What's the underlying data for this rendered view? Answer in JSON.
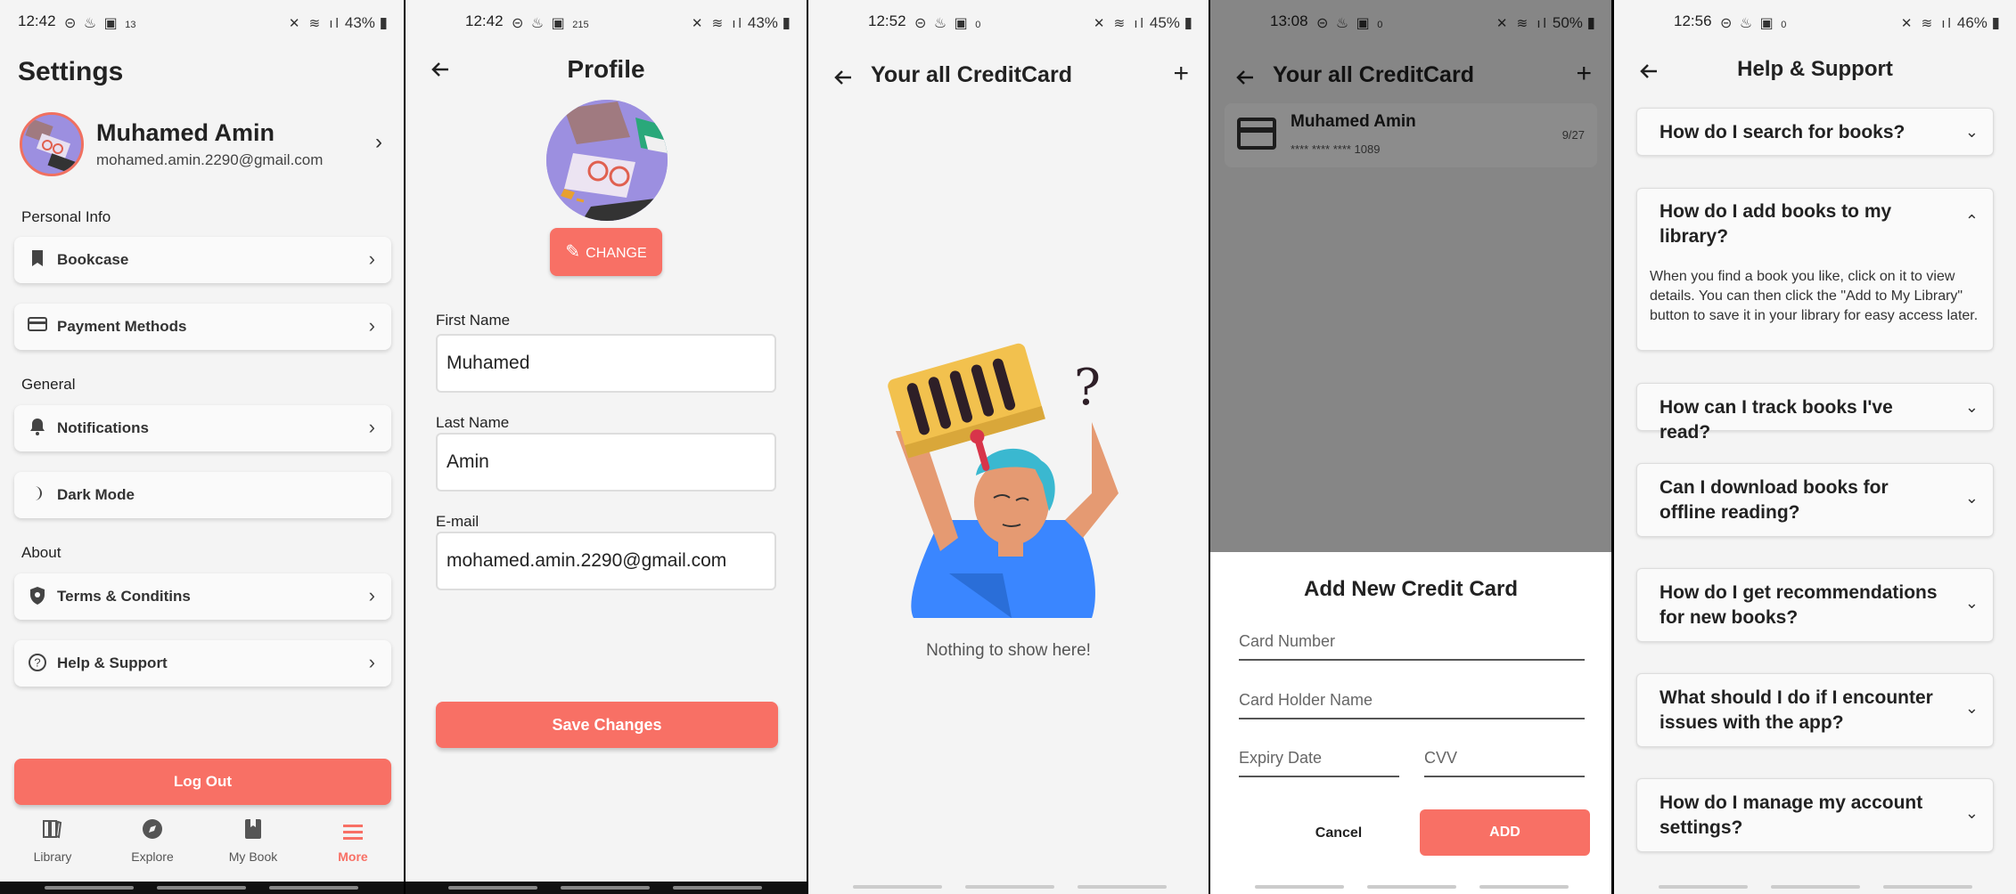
{
  "screens": {
    "settings": {
      "status": {
        "time": "12:42",
        "net": "13",
        "battery": "43%"
      },
      "title": "Settings",
      "profile": {
        "name": "Muhamed Amin",
        "email": "mohamed.amin.2290@gmail.com"
      },
      "sections": {
        "personal": "Personal Info",
        "general": "General",
        "about": "About"
      },
      "items": {
        "bookcase": "Bookcase",
        "payment": "Payment Methods",
        "notifications": "Notifications",
        "dark_mode": "Dark Mode",
        "terms": "Terms & Conditins",
        "help": "Help & Support"
      },
      "logout": "Log Out",
      "nav": {
        "library": "Library",
        "explore": "Explore",
        "my_book": "My Book",
        "more": "More"
      },
      "accent": "#f87065"
    },
    "profile": {
      "status": {
        "time": "12:42",
        "net": "215",
        "battery": "43%"
      },
      "title": "Profile",
      "change_button": "CHANGE",
      "fields": {
        "first_name_label": "First Name",
        "first_name_value": "Muhamed",
        "last_name_label": "Last Name",
        "last_name_value": "Amin",
        "email_label": "E-mail",
        "email_value": "mohamed.amin.2290@gmail.com"
      },
      "save_button": "Save Changes"
    },
    "credit_cards_empty": {
      "status": {
        "time": "12:52",
        "net": "0",
        "battery": "45%"
      },
      "title": "Your all CreditCard",
      "empty_text": "Nothing to show here!"
    },
    "credit_cards_add": {
      "status": {
        "time": "13:08",
        "net": "0",
        "battery": "50%"
      },
      "title": "Your all CreditCard",
      "card": {
        "holder": "Muhamed Amin",
        "number": "**** **** **** 1089",
        "expiry": "9/27"
      },
      "sheet": {
        "title": "Add New Credit Card",
        "card_number_placeholder": "Card Number",
        "holder_placeholder": "Card Holder Name",
        "expiry_placeholder": "Expiry Date",
        "cvv_placeholder": "CVV",
        "cancel": "Cancel",
        "add": "ADD"
      }
    },
    "help": {
      "status": {
        "time": "12:56",
        "net": "0",
        "battery": "46%"
      },
      "title": "Help & Support",
      "faqs": [
        {
          "q": "How do I search for books?",
          "expanded": false
        },
        {
          "q": "How do I add books to my library?",
          "expanded": true,
          "a": "When you find a book you like, click on it to view details. You can then click the \"Add to My Library\" button to save it in your library for easy access later."
        },
        {
          "q": "How can I track books I've read?",
          "expanded": false
        },
        {
          "q": "Can I download books for offline reading?",
          "expanded": false
        },
        {
          "q": "How do I get recommendations for new books?",
          "expanded": false
        },
        {
          "q": "What should I do if I encounter issues with the app?",
          "expanded": false
        },
        {
          "q": "How do I manage my account settings?",
          "expanded": false
        }
      ]
    }
  }
}
